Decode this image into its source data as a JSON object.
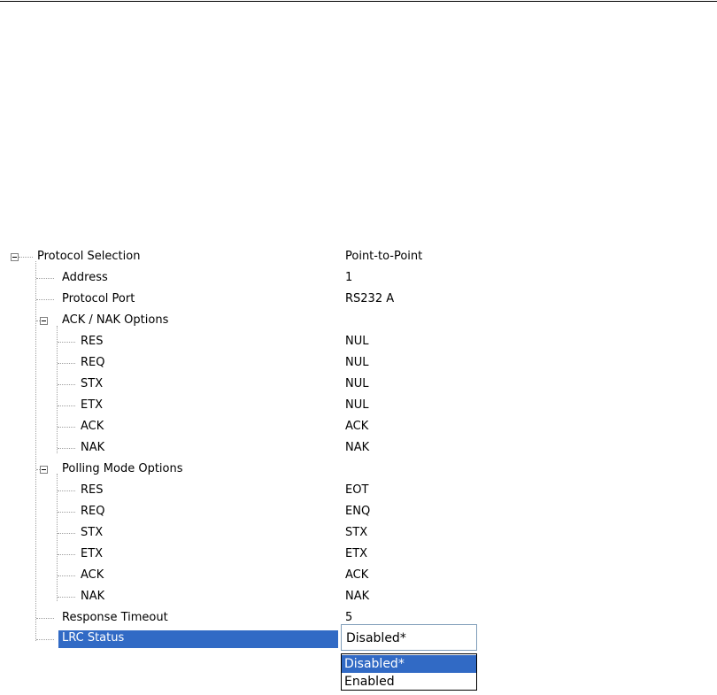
{
  "tree": {
    "rows": [
      {
        "label": "Protocol Selection",
        "value": "Point-to-Point"
      },
      {
        "label": "Address",
        "value": "1"
      },
      {
        "label": "Protocol Port",
        "value": "RS232 A"
      },
      {
        "label": "ACK / NAK Options",
        "value": ""
      },
      {
        "label": "RES",
        "value": "NUL"
      },
      {
        "label": "REQ",
        "value": "NUL"
      },
      {
        "label": "STX",
        "value": "NUL"
      },
      {
        "label": "ETX",
        "value": "NUL"
      },
      {
        "label": "ACK",
        "value": "ACK"
      },
      {
        "label": "NAK",
        "value": "NAK"
      },
      {
        "label": "Polling Mode Options",
        "value": ""
      },
      {
        "label": "RES",
        "value": "EOT"
      },
      {
        "label": "REQ",
        "value": "ENQ"
      },
      {
        "label": "STX",
        "value": "STX"
      },
      {
        "label": "ETX",
        "value": "ETX"
      },
      {
        "label": "ACK",
        "value": "ACK"
      },
      {
        "label": "NAK",
        "value": "NAK"
      },
      {
        "label": "Response Timeout",
        "value": "5"
      },
      {
        "label": "LRC Status",
        "value": ""
      }
    ],
    "selected_label": "LRC Status"
  },
  "combo": {
    "current_value": "Disabled*",
    "options": [
      "Disabled*",
      "Enabled"
    ],
    "selected_option": "Disabled*"
  },
  "colors": {
    "selection": "#316ac5",
    "tree_lines": "#a0a0a0"
  },
  "icons": {
    "expanded_node": "minus-box-icon"
  }
}
